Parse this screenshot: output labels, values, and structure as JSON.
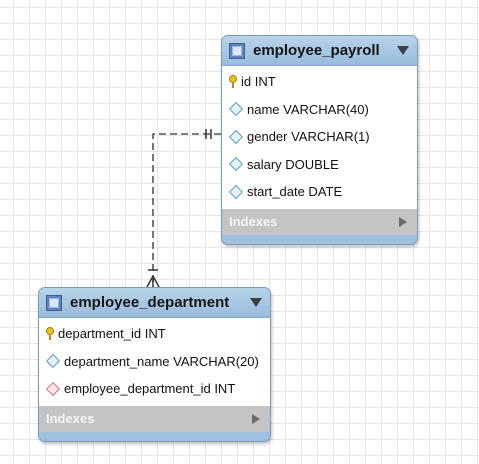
{
  "diagram": {
    "tables": [
      {
        "name": "employee_payroll",
        "columns": [
          {
            "label": "id INT",
            "icon": "primary-key-icon"
          },
          {
            "label": "name VARCHAR(40)",
            "icon": "column-diamond-icon"
          },
          {
            "label": "gender VARCHAR(1)",
            "icon": "column-diamond-icon"
          },
          {
            "label": "salary DOUBLE",
            "icon": "column-diamond-icon"
          },
          {
            "label": "start_date DATE",
            "icon": "column-diamond-icon"
          }
        ],
        "indexes_label": "Indexes"
      },
      {
        "name": "employee_department",
        "columns": [
          {
            "label": "department_id INT",
            "icon": "primary-key-icon"
          },
          {
            "label": "department_name VARCHAR(20)",
            "icon": "column-diamond-icon"
          },
          {
            "label": "employee_department_id INT",
            "icon": "foreign-key-diamond-icon"
          }
        ],
        "indexes_label": "Indexes"
      }
    ],
    "relationship": {
      "from": "employee_payroll",
      "to": "employee_department",
      "from_cardinality": "one-and-only-one",
      "to_cardinality": "one-or-many",
      "style": "dashed"
    }
  },
  "colors": {
    "header": "#a7c6e2",
    "indexes": "#c4c4c4",
    "pk_icon": "#e9c21b",
    "fk_icon": "#cf7c78",
    "column_icon": "#5e9fbd"
  }
}
